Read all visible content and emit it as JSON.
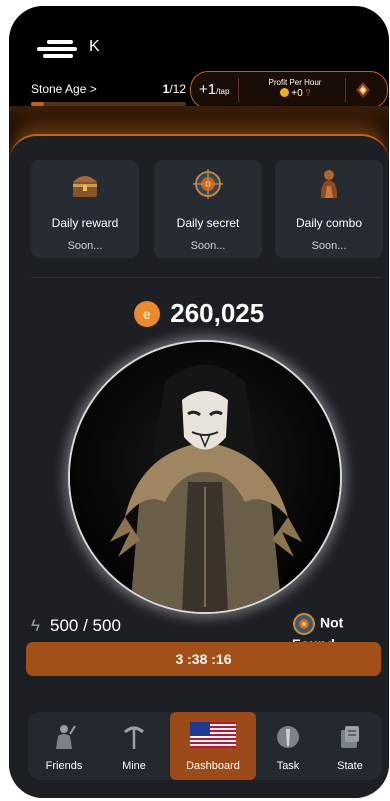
{
  "header": {
    "logo_letter": "K",
    "level_name": "Stone Age >",
    "level_current": "1",
    "level_total": "/12",
    "level_progress": 0.083,
    "tap_value": "+1",
    "tap_unit": "/tap",
    "profit_label": "Profit Per Hour",
    "profit_value": "+0",
    "profit_help": "?"
  },
  "cards": [
    {
      "title": "Daily reward",
      "status": "Soon...",
      "icon": "treasure-chest-icon"
    },
    {
      "title": "Daily secret",
      "status": "Soon...",
      "icon": "target-compass-icon"
    },
    {
      "title": "Daily combo",
      "status": "Soon...",
      "icon": "figurine-icon"
    }
  ],
  "balance": {
    "coin_symbol": "e",
    "amount": "260,025"
  },
  "energy": {
    "value": "500 / 500"
  },
  "status": {
    "label": "Not Found"
  },
  "timer": {
    "value": "3 :38 :16"
  },
  "nav": [
    {
      "label": "Friends",
      "icon": "caveman-icon"
    },
    {
      "label": "Mine",
      "icon": "pickaxe-icon"
    },
    {
      "label": "Dashboard",
      "icon": "us-flag-icon",
      "active": true
    },
    {
      "label": "Task",
      "icon": "task-icon"
    },
    {
      "label": "State",
      "icon": "state-icon"
    }
  ],
  "colors": {
    "accent": "#c0651e",
    "panel": "#1c1f24",
    "card": "#272b32",
    "timer": "#a24f18"
  }
}
